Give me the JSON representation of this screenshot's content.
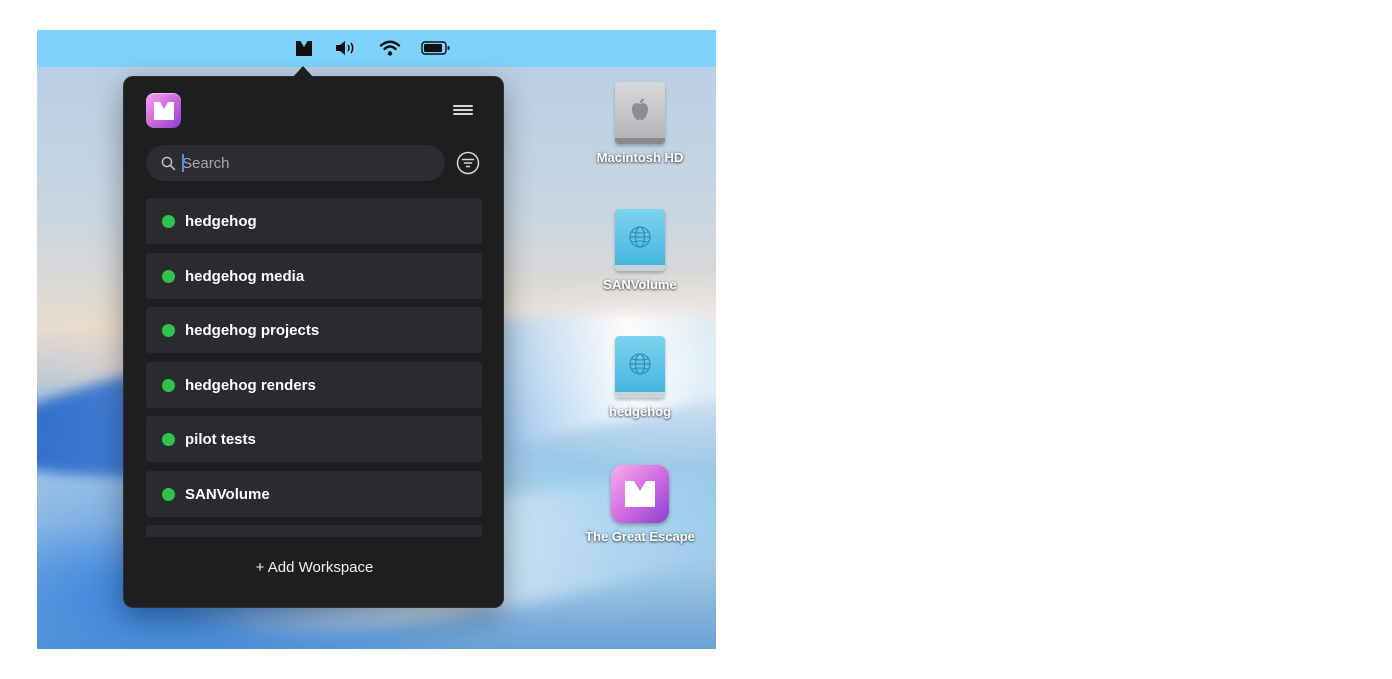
{
  "menubar": {
    "icons": [
      "app-menu-icon",
      "volume-icon",
      "wifi-icon",
      "battery-icon"
    ]
  },
  "popover": {
    "logo_icon": "app-logo-icon",
    "menu_icon": "hamburger-icon",
    "search": {
      "placeholder": "Search",
      "value": ""
    },
    "filter_icon": "filter-icon",
    "workspaces": [
      {
        "label": "hedgehog",
        "status": "connected"
      },
      {
        "label": "hedgehog media",
        "status": "connected"
      },
      {
        "label": "hedgehog projects",
        "status": "connected"
      },
      {
        "label": "hedgehog renders",
        "status": "connected"
      },
      {
        "label": "pilot tests",
        "status": "connected"
      },
      {
        "label": "SANVolume",
        "status": "connected"
      }
    ],
    "add_workspace_label": "+ Add Workspace"
  },
  "desktop": {
    "items": [
      {
        "label": "Macintosh HD",
        "icon": "hard-drive-icon"
      },
      {
        "label": "SANVolume",
        "icon": "network-drive-icon"
      },
      {
        "label": "hedgehog",
        "icon": "network-drive-icon"
      },
      {
        "label": "The Great Escape",
        "icon": "app-icon"
      }
    ]
  },
  "colors": {
    "menubar": "#7fd2fb",
    "popover_bg": "#1d1e20",
    "row_bg": "#2a2b2e",
    "status_connected": "#30c34a",
    "accent": "#4a8dff"
  }
}
